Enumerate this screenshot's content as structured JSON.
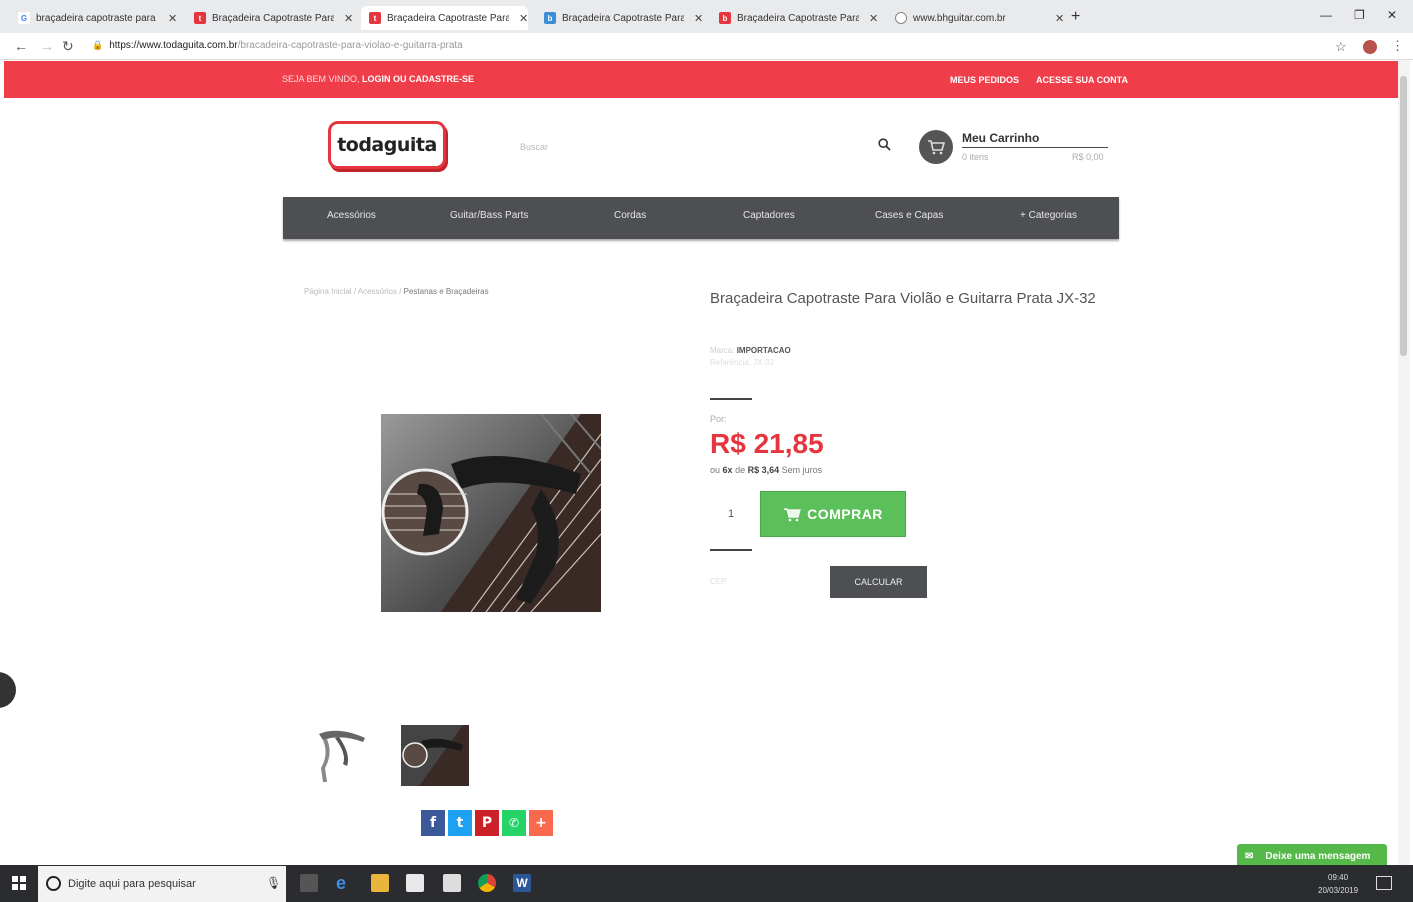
{
  "browser": {
    "tabs": [
      {
        "title": "braçadeira capotraste para violã",
        "icon": "google-icon",
        "color": "#4285f4"
      },
      {
        "title": "Braçadeira Capotraste Para Violã",
        "icon": "todaguita-favicon",
        "color": "#e53640"
      },
      {
        "title": "Braçadeira Capotraste Para Violã",
        "icon": "todaguita-favicon",
        "color": "#e53640"
      },
      {
        "title": "Braçadeira Capotraste Para Violã",
        "icon": "store-favicon",
        "color": "#3c8dd8"
      },
      {
        "title": "Braçadeira Capotraste Para Violã",
        "icon": "store-favicon-red",
        "color": "#e53640"
      },
      {
        "title": "www.bhguitar.com.br",
        "icon": "globe-icon",
        "color": "#888888"
      }
    ],
    "url_host": "https://www.todaguita.com.br",
    "url_path": "/bracadeira-capotraste-para-violao-e-guitarra-prata"
  },
  "topbar": {
    "welcome": "SEJA BEM VINDO,",
    "login": "LOGIN OU CADASTRE-SE",
    "orders": "MEUS PEDIDOS",
    "account": "ACESSE SUA CONTA",
    "color": "#ef3e4a"
  },
  "header": {
    "logo": "todaguita",
    "search_placeholder": "Buscar",
    "cart_title": "Meu Carrinho",
    "cart_items": "0 itens",
    "cart_total": "R$ 0,00"
  },
  "categories": [
    "Acessórios",
    "Guitar/Bass Parts",
    "Cordas",
    "Captadores",
    "Cases e Capas",
    "+ Categorias"
  ],
  "breadcrumb": {
    "home": "Página Inicial",
    "sep": " / ",
    "section": "Acessórios",
    "current": "Pestanas e Braçadeiras"
  },
  "product": {
    "title": "Braçadeira Capotraste Para Violão e Guitarra Prata JX-32",
    "brand_label": "Marca:",
    "brand": "IMPORTACAO",
    "ref": "Referência: JX-32",
    "price_prefix": "Por:",
    "price": "R$ 21,85",
    "install_prefix": "ou",
    "install_count": "6x",
    "install_mid": "de",
    "install_value": "R$ 3,64",
    "install_suffix": "Sem juros",
    "quantity": "1",
    "buy_label": "COMPRAR",
    "cep_label": "CEP",
    "calc_label": "CALCULAR",
    "price_color": "#e53640",
    "buy_color": "#5bc05a"
  },
  "share": [
    {
      "icon": "facebook-icon",
      "glyph": "f",
      "color": "#3b5998"
    },
    {
      "icon": "twitter-icon",
      "glyph": "t",
      "color": "#1da1f2"
    },
    {
      "icon": "pinterest-icon",
      "glyph": "P",
      "color": "#cb2027"
    },
    {
      "icon": "whatsapp-icon",
      "glyph": "✆",
      "color": "#25d366"
    },
    {
      "icon": "more-share-icon",
      "glyph": "+",
      "color": "#f8694d"
    }
  ],
  "chat": {
    "label": "Deixe uma mensagem"
  },
  "taskbar": {
    "search_placeholder": "Digite aqui para pesquisar",
    "time": "09:40",
    "date": "20/03/2019"
  }
}
